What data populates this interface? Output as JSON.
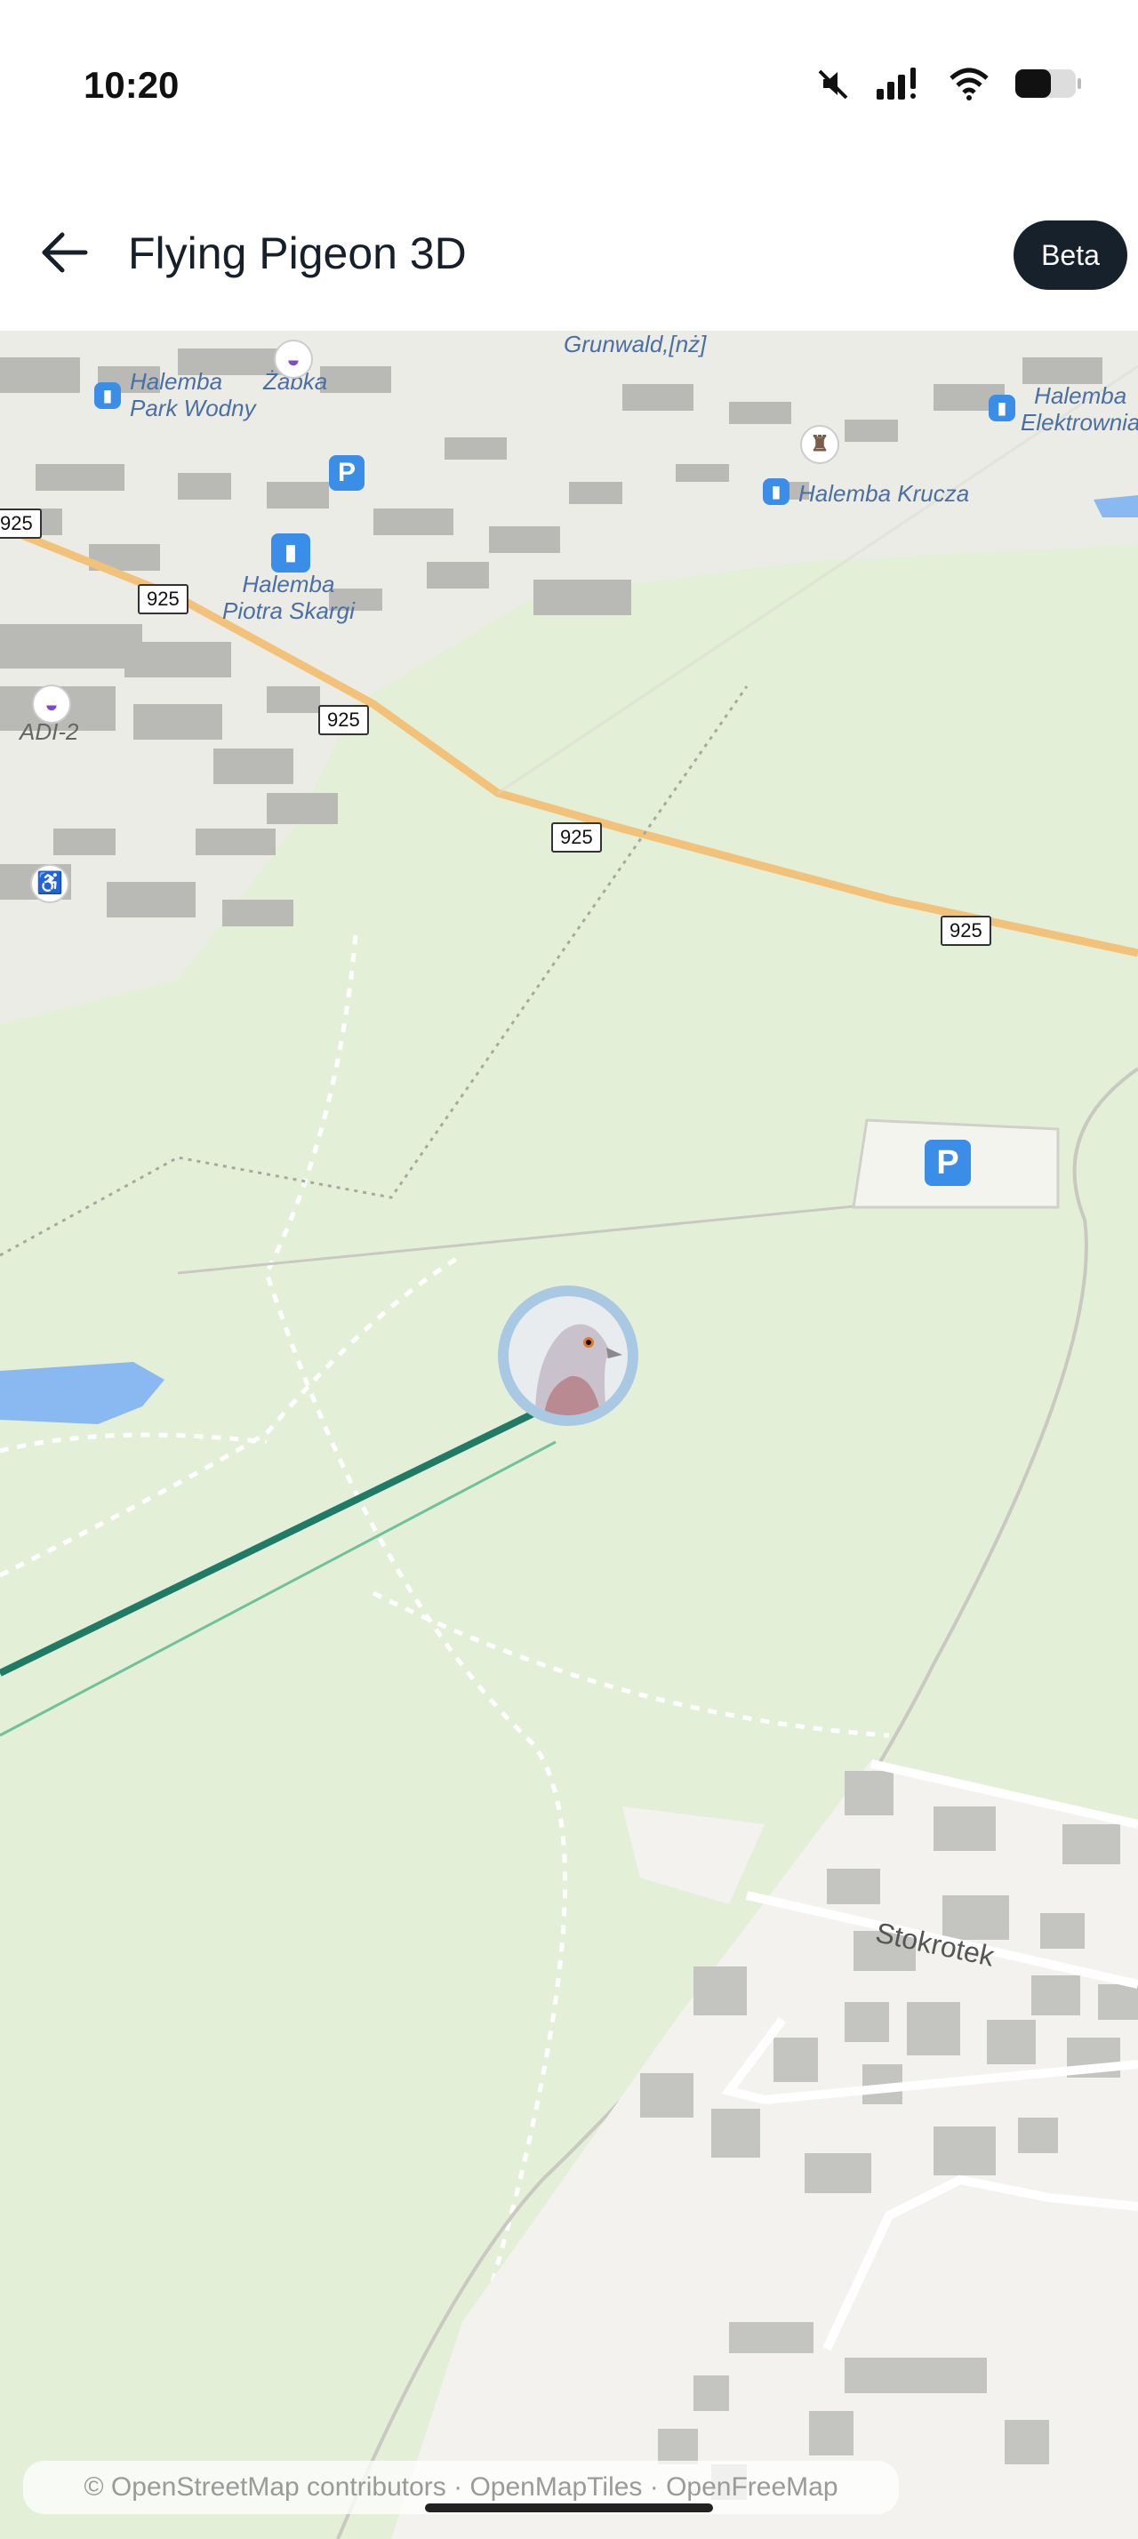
{
  "status_bar": {
    "time": "10:20",
    "icons": [
      "mute-icon",
      "signal-icon",
      "wifi-icon",
      "battery-icon"
    ]
  },
  "header": {
    "back_icon": "arrow-left-icon",
    "title": "Flying Pigeon 3D",
    "badge": "Beta"
  },
  "map": {
    "labels": {
      "grunwald": "Grunwald,[nż]",
      "halemba_park_wodny": "Halemba\nPark Wodny",
      "zabka": "Żabka",
      "halemba_elektrownia": "Halemba\nElektrownia",
      "halemba_krucza": "Halemba Krucza",
      "halemba_piotra_skargi": "Halemba\nPiotra Skargi",
      "adi2": "ADI-2",
      "stokrotek": "Stokrotek"
    },
    "road_number": "925",
    "parking_symbol": "P",
    "marker_icon": "pigeon-icon"
  },
  "attribution": "© OpenStreetMap contributors · OpenMapTiles · OpenFreeMap",
  "colors": {
    "route": "#1f7a66",
    "water": "#8ab8f0",
    "land": "#e4efd8",
    "road": "#f3c27a",
    "badge_bg": "#17212b"
  }
}
